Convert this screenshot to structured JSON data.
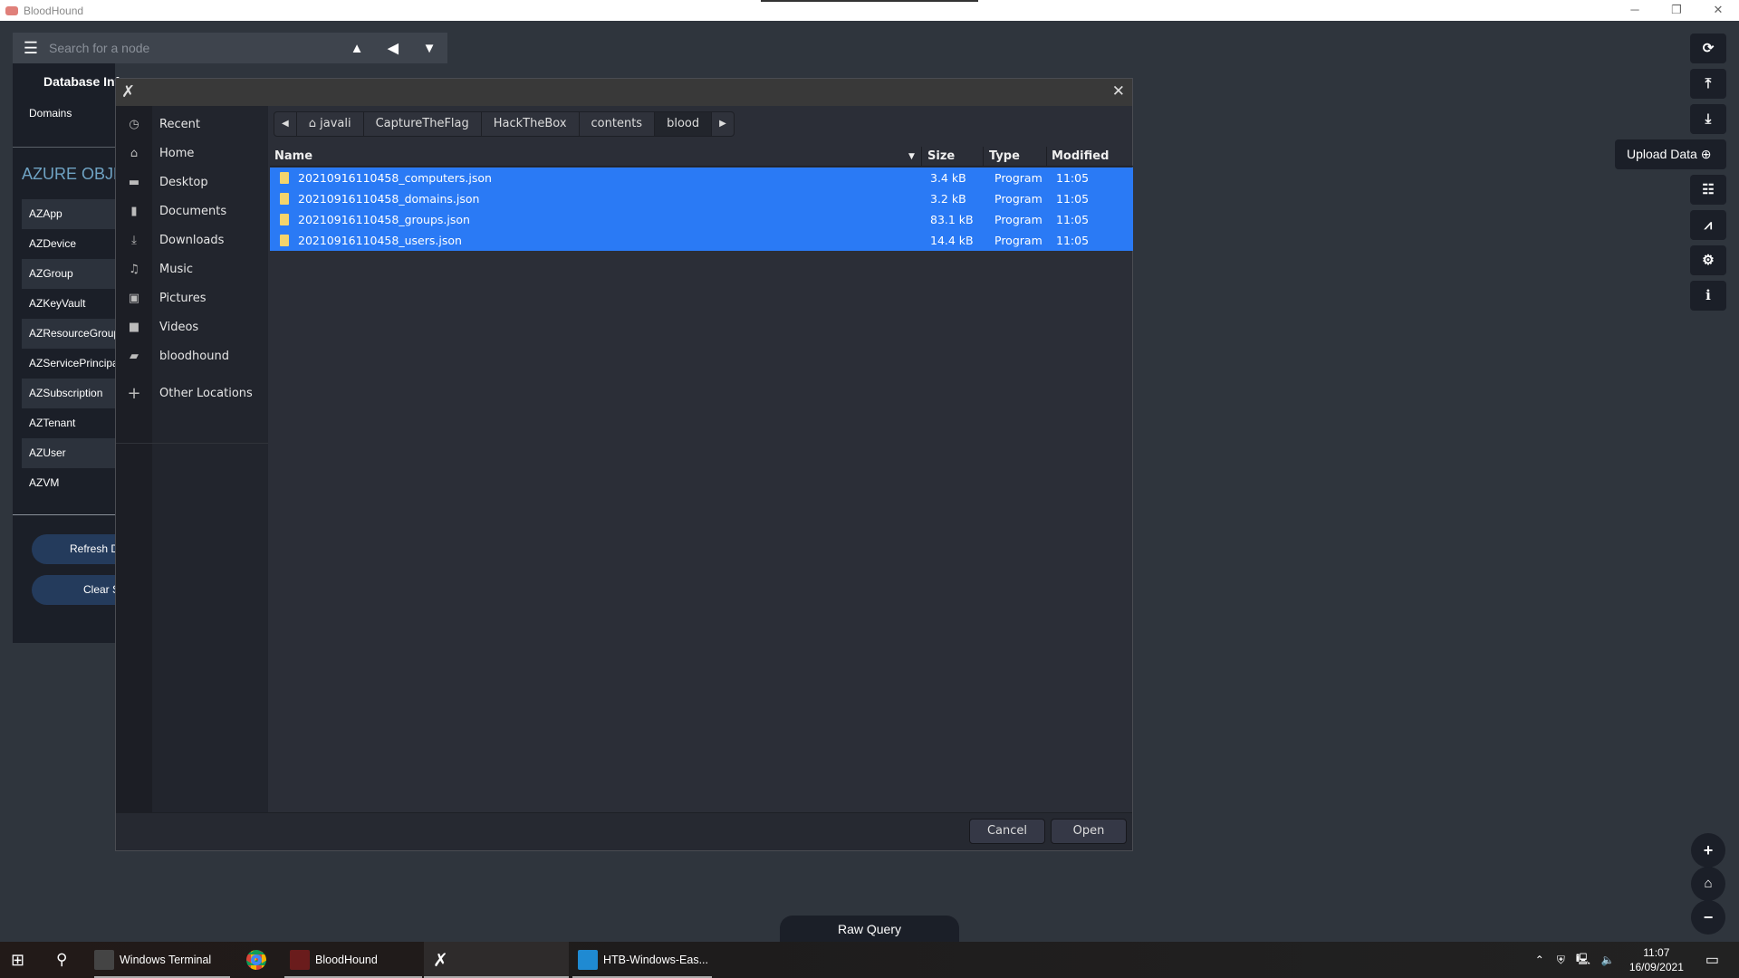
{
  "window": {
    "title": "BloodHound",
    "controls": [
      "─",
      "❐",
      "✕"
    ]
  },
  "search": {
    "placeholder": "Search for a node",
    "menu_icon": "hamburger-icon",
    "tools": [
      "▲",
      "◀",
      "▼"
    ]
  },
  "left_panel": {
    "db_info": "Database Info",
    "domains": "Domains",
    "azure_header": "AZURE OBJECTS",
    "azure_items": [
      "AZApp",
      "AZDevice",
      "AZGroup",
      "AZKeyVault",
      "AZResourceGroup",
      "AZServicePrincipal",
      "AZSubscription",
      "AZTenant",
      "AZUser",
      "AZVM"
    ],
    "refresh": "Refresh Database Stats",
    "clear": "Clear Sessions"
  },
  "dialog": {
    "places": [
      {
        "label": "Recent",
        "icon": "◷"
      },
      {
        "label": "Home",
        "icon": "⌂"
      },
      {
        "label": "Desktop",
        "icon": "▬"
      },
      {
        "label": "Documents",
        "icon": "▮"
      },
      {
        "label": "Downloads",
        "icon": "⤓"
      },
      {
        "label": "Music",
        "icon": "♫"
      },
      {
        "label": "Pictures",
        "icon": "▣"
      },
      {
        "label": "Videos",
        "icon": "■"
      },
      {
        "label": "bloodhound",
        "icon": "▰"
      }
    ],
    "other_locations": "Other Locations",
    "path": [
      "javali",
      "CaptureTheFlag",
      "HackTheBox",
      "contents",
      "blood"
    ],
    "columns": {
      "name": "Name",
      "size": "Size",
      "type": "Type",
      "modified": "Modified"
    },
    "files": [
      {
        "name": "20210916110458_computers.json",
        "size": "3.4 kB",
        "type": "Program",
        "modified": "11:05"
      },
      {
        "name": "20210916110458_domains.json",
        "size": "3.2 kB",
        "type": "Program",
        "modified": "11:05"
      },
      {
        "name": "20210916110458_groups.json",
        "size": "83.1 kB",
        "type": "Program",
        "modified": "11:05"
      },
      {
        "name": "20210916110458_users.json",
        "size": "14.4 kB",
        "type": "Program",
        "modified": "11:05"
      }
    ],
    "cancel": "Cancel",
    "open": "Open"
  },
  "right_toolbar": {
    "upload_tooltip": "Upload Data"
  },
  "raw_query": "Raw Query",
  "taskbar": {
    "apps": [
      "Windows Terminal",
      "BloodHound",
      "HTB-Windows-Eas..."
    ],
    "time": "11:07",
    "date": "16/09/2021"
  },
  "colors": {
    "selection": "#2a7af5",
    "background": "#2f353d"
  }
}
